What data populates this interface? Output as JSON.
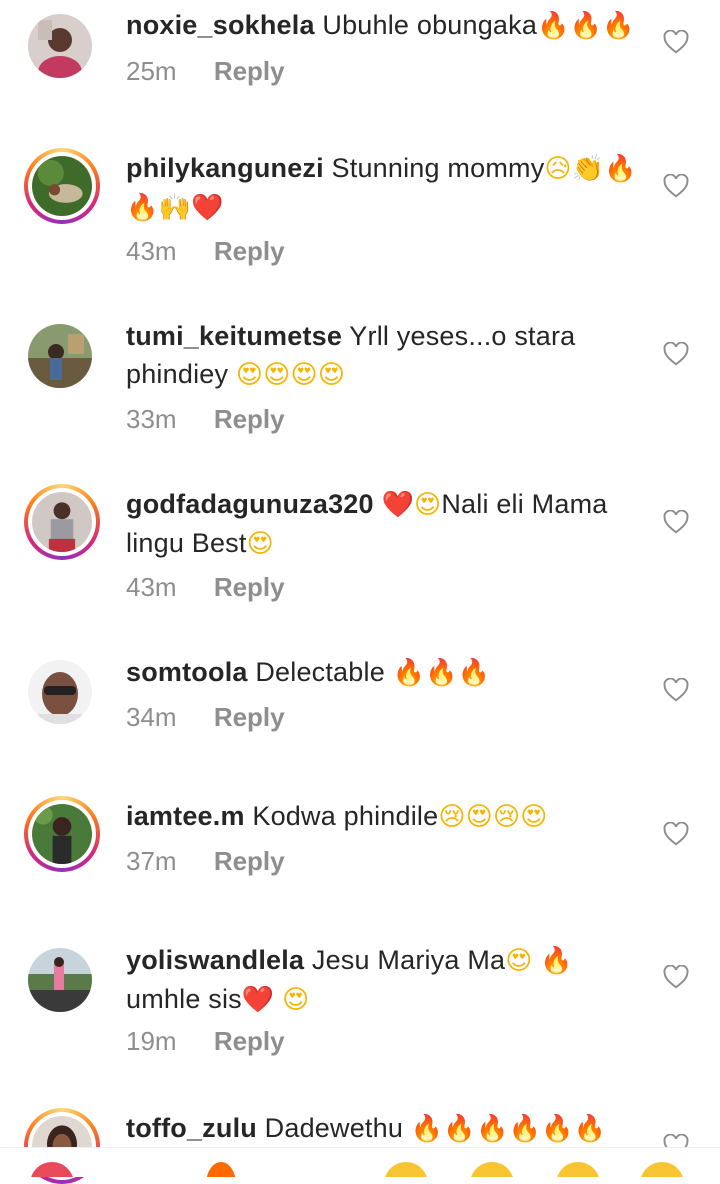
{
  "comments": [
    {
      "username": "noxie_sokhela",
      "text": "Ubuhle obungaka",
      "emojis": [
        "🔥",
        "🔥",
        "🔥"
      ],
      "time": "25m",
      "reply": "Reply"
    },
    {
      "username": "philykangunezi",
      "text": "Stunning mommy",
      "emojis": [
        "😥",
        "👏",
        "🔥",
        "🔥",
        "🙌",
        "❤️"
      ],
      "time": "43m",
      "reply": "Reply"
    },
    {
      "username": "tumi_keitumetse",
      "text": "Yrll yeses...o stara phindiey",
      "emojis": [
        "😍",
        "😍",
        "😍",
        "😍"
      ],
      "time": "33m",
      "reply": "Reply"
    },
    {
      "username": "godfadagunuza320",
      "text_a": "Nali eli Mama lingu Best",
      "emojis_lead": [
        "❤️",
        "😍"
      ],
      "emojis": [
        "😍"
      ],
      "time": "43m",
      "reply": "Reply"
    },
    {
      "username": "somtoola",
      "text": "Delectable",
      "emojis": [
        "🔥",
        "🔥",
        "🔥"
      ],
      "time": "34m",
      "reply": "Reply"
    },
    {
      "username": "iamtee.m",
      "text": "Kodwa phindile",
      "emojis": [
        "😢",
        "😍",
        "😢",
        "😍"
      ],
      "time": "37m",
      "reply": "Reply"
    },
    {
      "username": "yoliswandlela",
      "text_a": "Jesu Mariya Ma",
      "text_b": "umhle sis",
      "emojis_mid": [
        "😍",
        "🔥"
      ],
      "emojis": [
        "❤️",
        "😍"
      ],
      "time": "19m",
      "reply": "Reply"
    },
    {
      "username": "toffo_zulu",
      "text": "Dadewethu",
      "emojis": [
        "🔥",
        "🔥",
        "🔥",
        "🔥",
        "🔥",
        "🔥"
      ],
      "time": "",
      "reply": ""
    }
  ],
  "icons": {
    "like": "heart-outline-icon"
  },
  "colors": {
    "username": "#262626",
    "meta": "#8e8e8e",
    "story_ring": "#d62976"
  }
}
